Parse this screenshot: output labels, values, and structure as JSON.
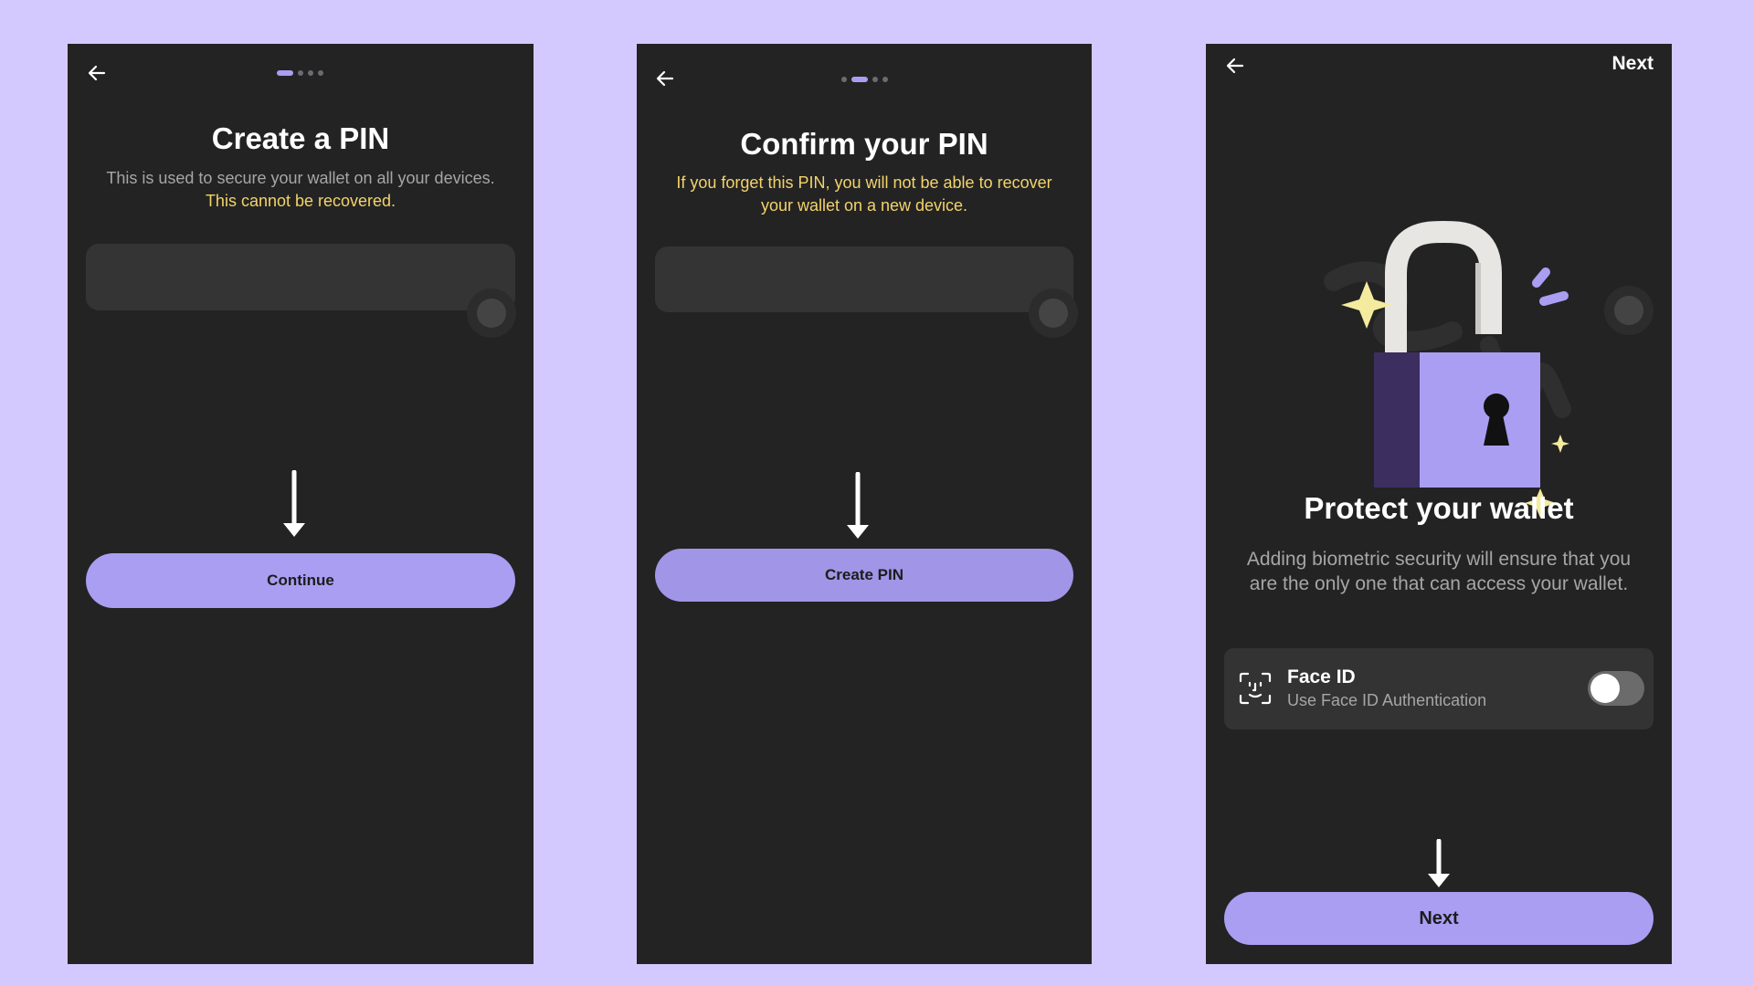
{
  "colors": {
    "background": "#d3c9fe",
    "screen": "#232323",
    "accent": "#a99ef2",
    "warning": "#f3d36a",
    "muted_text": "#a6a6a6"
  },
  "screens": [
    {
      "back_icon": "arrow-left-icon",
      "progress": {
        "total": 4,
        "active": 1
      },
      "title": "Create a PIN",
      "subtitle": "This is used to secure your wallet on all your devices.",
      "warning": "This cannot be recovered.",
      "pin_input": {
        "value": ""
      },
      "cta": "Continue",
      "pointer_icon": "arrow-down-icon"
    },
    {
      "back_icon": "arrow-left-icon",
      "progress": {
        "total": 4,
        "active": 2
      },
      "title": "Confirm your PIN",
      "warning": "If you forget this PIN, you will not be able to recover your wallet on a new device.",
      "pin_input": {
        "value": ""
      },
      "cta": "Create PIN",
      "pointer_icon": "arrow-down-icon"
    },
    {
      "back_icon": "arrow-left-icon",
      "header_action": "Next",
      "illustration": "padlock-illustration",
      "title": "Protect your wallet",
      "description": "Adding biometric security will ensure that you are the only one that can access your wallet.",
      "face_id": {
        "icon": "face-id-icon",
        "title": "Face ID",
        "subtitle": "Use Face ID Authentication",
        "enabled": false
      },
      "cta": "Next",
      "pointer_icon": "arrow-down-icon"
    }
  ]
}
